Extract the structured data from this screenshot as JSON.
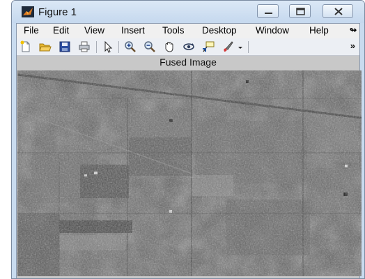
{
  "window": {
    "title": "Figure 1"
  },
  "menu": {
    "items": [
      "File",
      "Edit",
      "View",
      "Insert",
      "Tools",
      "Desktop",
      "Window",
      "Help"
    ],
    "overflow_icon": "chevron-right-icon"
  },
  "toolbar": {
    "icons": [
      "new-figure-icon",
      "open-file-icon",
      "save-icon",
      "print-icon",
      "pointer-icon",
      "zoom-in-icon",
      "zoom-out-icon",
      "pan-hand-icon",
      "rotate-3d-icon",
      "data-cursor-icon",
      "brush-icon",
      "dropdown-arrow-icon",
      "overflow-icon"
    ],
    "overflow_glyph": "»"
  },
  "figure": {
    "axes_title": "Fused Image"
  },
  "colors": {
    "window_frame": "#c9dbef",
    "figure_background": "#c8c8c8",
    "image_tone": "#585858"
  }
}
